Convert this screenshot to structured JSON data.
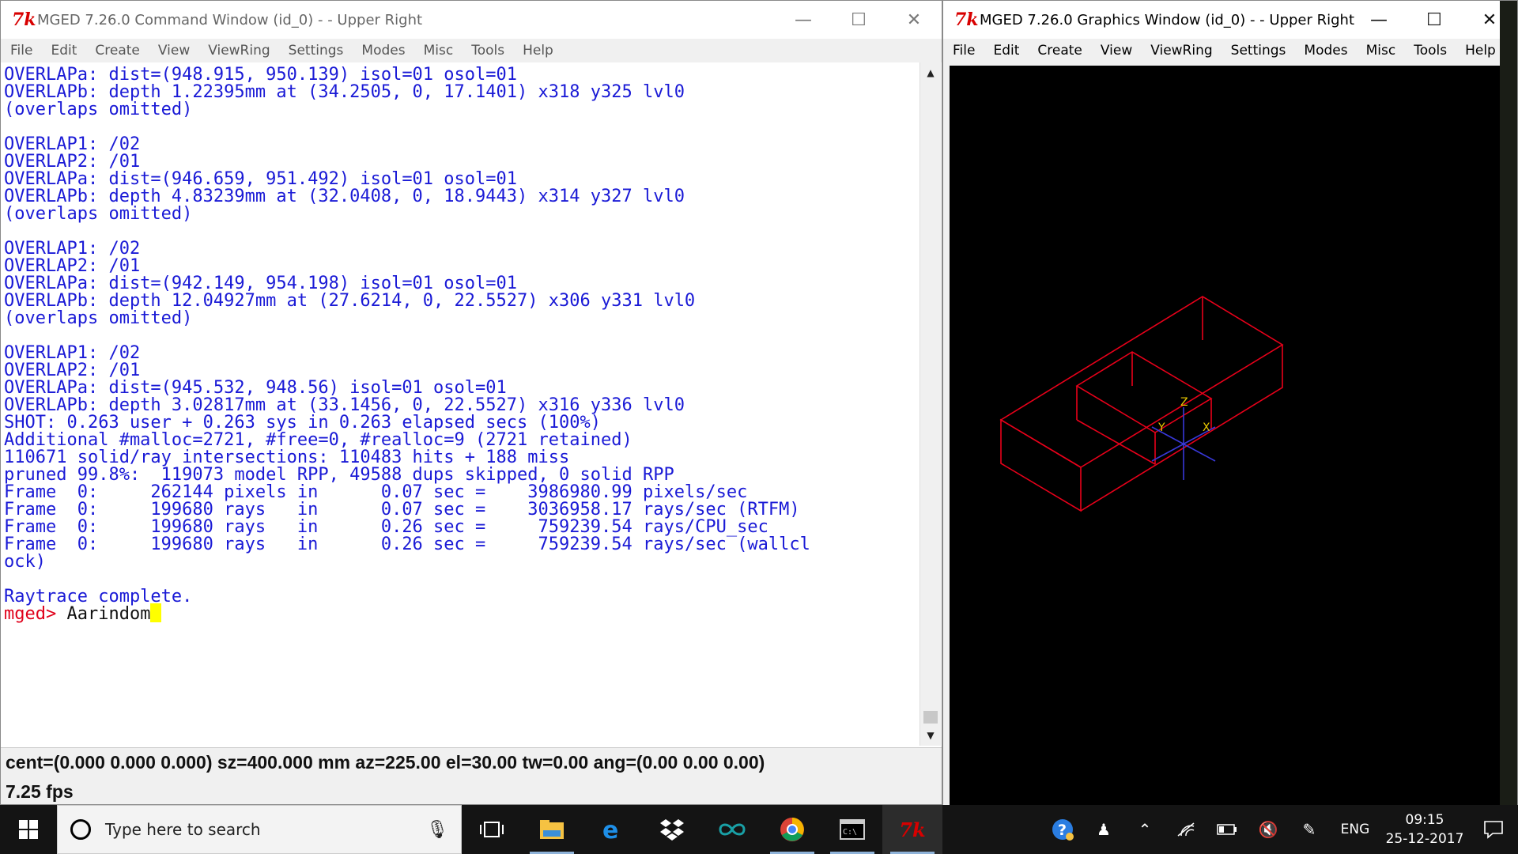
{
  "command_window": {
    "title": "MGED 7.26.0 Command Window (id_0) -  - Upper Right",
    "menu": [
      "File",
      "Edit",
      "Create",
      "View",
      "ViewRing",
      "Settings",
      "Modes",
      "Misc",
      "Tools",
      "Help"
    ],
    "console_lines": [
      "OVERLAPa: dist=(948.915, 950.139) isol=01 osol=01",
      "OVERLAPb: depth 1.22395mm at (34.2505, 0, 17.1401) x318 y325 lvl0",
      "(overlaps omitted)",
      "",
      "OVERLAP1: /02",
      "OVERLAP2: /01",
      "OVERLAPa: dist=(946.659, 951.492) isol=01 osol=01",
      "OVERLAPb: depth 4.83239mm at (32.0408, 0, 18.9443) x314 y327 lvl0",
      "(overlaps omitted)",
      "",
      "OVERLAP1: /02",
      "OVERLAP2: /01",
      "OVERLAPa: dist=(942.149, 954.198) isol=01 osol=01",
      "OVERLAPb: depth 12.04927mm at (27.6214, 0, 22.5527) x306 y331 lvl0",
      "(overlaps omitted)",
      "",
      "OVERLAP1: /02",
      "OVERLAP2: /01",
      "OVERLAPa: dist=(945.532, 948.56) isol=01 osol=01",
      "OVERLAPb: depth 3.02817mm at (33.1456, 0, 22.5527) x316 y336 lvl0",
      "SHOT: 0.263 user + 0.263 sys in 0.263 elapsed secs (100%)",
      "Additional #malloc=2721, #free=0, #realloc=9 (2721 retained)",
      "110671 solid/ray intersections: 110483 hits + 188 miss",
      "pruned 99.8%:  119073 model RPP, 49588 dups skipped, 0 solid RPP",
      "Frame  0:     262144 pixels in      0.07 sec =    3986980.99 pixels/sec",
      "Frame  0:     199680 rays   in      0.07 sec =    3036958.17 rays/sec (RTFM)",
      "Frame  0:     199680 rays   in      0.26 sec =     759239.54 rays/CPU_sec",
      "Frame  0:     199680 rays   in      0.26 sec =     759239.54 rays/sec (wallcl",
      "ock)",
      "",
      "Raytrace complete."
    ],
    "prompt": "mged>",
    "command_input": "Aarindom",
    "status_line1": "cent=(0.000 0.000 0.000) sz=400.000  mm  az=225.00  el=30.00  tw=0.00  ang=(0.00 0.00 0.00)",
    "status_line2": "7.25 fps"
  },
  "graphics_window": {
    "title": "MGED 7.26.0 Graphics Window (id_0) -  - Upper Right",
    "menu": [
      "File",
      "Edit",
      "Create",
      "View",
      "ViewRing",
      "Settings",
      "Modes",
      "Misc",
      "Tools",
      "Help"
    ],
    "axes_labels": {
      "x": "X",
      "y": "Y",
      "z": "Z"
    },
    "colors": {
      "wireframe": "#e8001a",
      "axes": "#3838d8",
      "axis_labels": "#e8c800",
      "background": "#000000"
    }
  },
  "taskbar": {
    "search_placeholder": "Type here to search",
    "language": "ENG",
    "time": "09:15",
    "date": "25-12-2017"
  }
}
